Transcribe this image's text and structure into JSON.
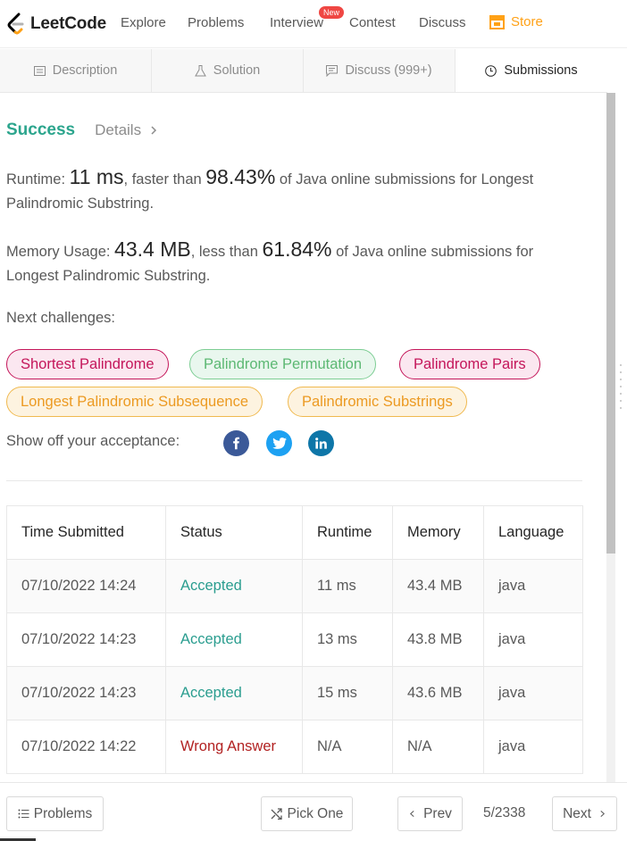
{
  "nav": {
    "logo_text": "LeetCode",
    "items": [
      "Explore",
      "Problems",
      "Interview",
      "Contest",
      "Discuss"
    ],
    "badge": "New",
    "store": "Store",
    "brand_color": "#ffa116"
  },
  "tabs": [
    {
      "label": "Description",
      "icon": "description-icon"
    },
    {
      "label": "Solution",
      "icon": "flask-icon"
    },
    {
      "label": "Discuss (999+)",
      "icon": "chat-icon"
    },
    {
      "label": "Submissions",
      "icon": "clock-icon",
      "active": true
    }
  ],
  "result": {
    "status": "Success",
    "details": "Details",
    "runtime_label": "Runtime: ",
    "runtime_value": "11 ms",
    "runtime_mid": ", faster than ",
    "runtime_pct": "98.43%",
    "runtime_tail": " of Java online submissions for Longest Palindromic Substring.",
    "memory_label": "Memory Usage: ",
    "memory_value": "43.4 MB",
    "memory_mid": ", less than ",
    "memory_pct": "61.84%",
    "memory_tail": " of Java online submissions for Longest Palindromic Substring."
  },
  "next_challenges": {
    "label": "Next challenges:",
    "items": [
      {
        "label": "Shortest Palindrome",
        "difficulty": "hard"
      },
      {
        "label": "Palindrome Permutation",
        "difficulty": "easy"
      },
      {
        "label": "Palindrome Pairs",
        "difficulty": "hard"
      },
      {
        "label": "Longest Palindromic Subsequence",
        "difficulty": "medium"
      },
      {
        "label": "Palindromic Substrings",
        "difficulty": "medium"
      }
    ]
  },
  "share": {
    "label": "Show off your acceptance:",
    "icons": [
      "facebook-icon",
      "twitter-icon",
      "linkedin-icon"
    ]
  },
  "table": {
    "headers": [
      "Time Submitted",
      "Status",
      "Runtime",
      "Memory",
      "Language"
    ],
    "rows": [
      [
        "07/10/2022 14:24",
        "Accepted",
        "11 ms",
        "43.4 MB",
        "java"
      ],
      [
        "07/10/2022 14:23",
        "Accepted",
        "13 ms",
        "43.8 MB",
        "java"
      ],
      [
        "07/10/2022 14:23",
        "Accepted",
        "15 ms",
        "43.6 MB",
        "java"
      ],
      [
        "07/10/2022 14:22",
        "Wrong Answer",
        "N/A",
        "N/A",
        "java"
      ]
    ]
  },
  "bottom": {
    "problems": "Problems",
    "pick_one": "Pick One",
    "prev": "Prev",
    "pager": "5/2338",
    "next": "Next"
  }
}
